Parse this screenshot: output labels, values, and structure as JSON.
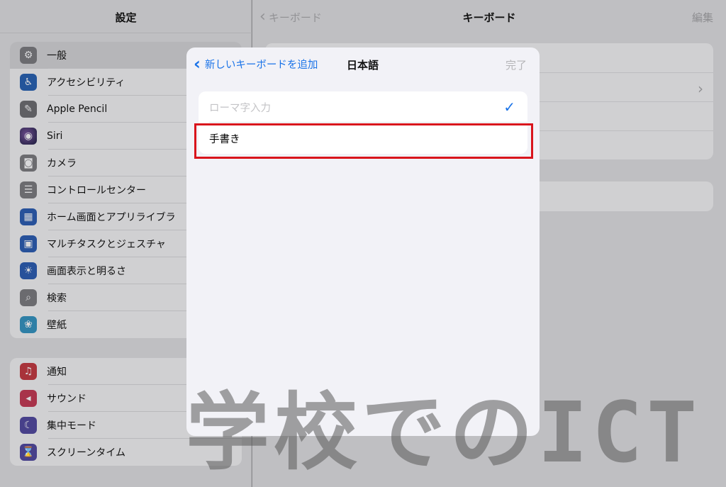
{
  "sidebar": {
    "title": "設定",
    "group1": [
      {
        "label": "一般",
        "icon": "gear-icon",
        "glyph": "⚙",
        "selected": true
      },
      {
        "label": "アクセシビリティ",
        "icon": "accessibility-icon",
        "glyph": "♿"
      },
      {
        "label": "Apple Pencil",
        "icon": "pencil-icon",
        "glyph": "✎"
      },
      {
        "label": "Siri",
        "icon": "siri-icon",
        "glyph": "◉"
      },
      {
        "label": "カメラ",
        "icon": "camera-icon",
        "glyph": "◙"
      },
      {
        "label": "コントロールセンター",
        "icon": "control-center-icon",
        "glyph": "☰"
      },
      {
        "label": "ホーム画面とアプリライブラ",
        "icon": "home-screen-icon",
        "glyph": "▦"
      },
      {
        "label": "マルチタスクとジェスチャ",
        "icon": "multitasking-icon",
        "glyph": "▣"
      },
      {
        "label": "画面表示と明るさ",
        "icon": "brightness-icon",
        "glyph": "☀"
      },
      {
        "label": "検索",
        "icon": "search-icon",
        "glyph": "⌕"
      },
      {
        "label": "壁紙",
        "icon": "wallpaper-icon",
        "glyph": "❀"
      }
    ],
    "group2": [
      {
        "label": "通知",
        "icon": "bell-icon",
        "glyph": "♫"
      },
      {
        "label": "サウンド",
        "icon": "speaker-icon",
        "glyph": "◂"
      },
      {
        "label": "集中モード",
        "icon": "moon-icon",
        "glyph": "☾"
      },
      {
        "label": "スクリーンタイム",
        "icon": "hourglass-icon",
        "glyph": "⌛"
      }
    ]
  },
  "main": {
    "back_label": "キーボード",
    "title": "キーボード",
    "edit_label": "編集"
  },
  "modal": {
    "back_label": "新しいキーボードを追加",
    "title": "日本語",
    "done_label": "完了",
    "items": [
      {
        "label": "ローマ字入力",
        "checked": true,
        "disabled": true
      },
      {
        "label": "手書き",
        "checked": false,
        "disabled": false
      }
    ]
  },
  "watermark": "学校でのICT",
  "colors": {
    "accent": "#1a73e8",
    "highlight": "#d9141c"
  }
}
